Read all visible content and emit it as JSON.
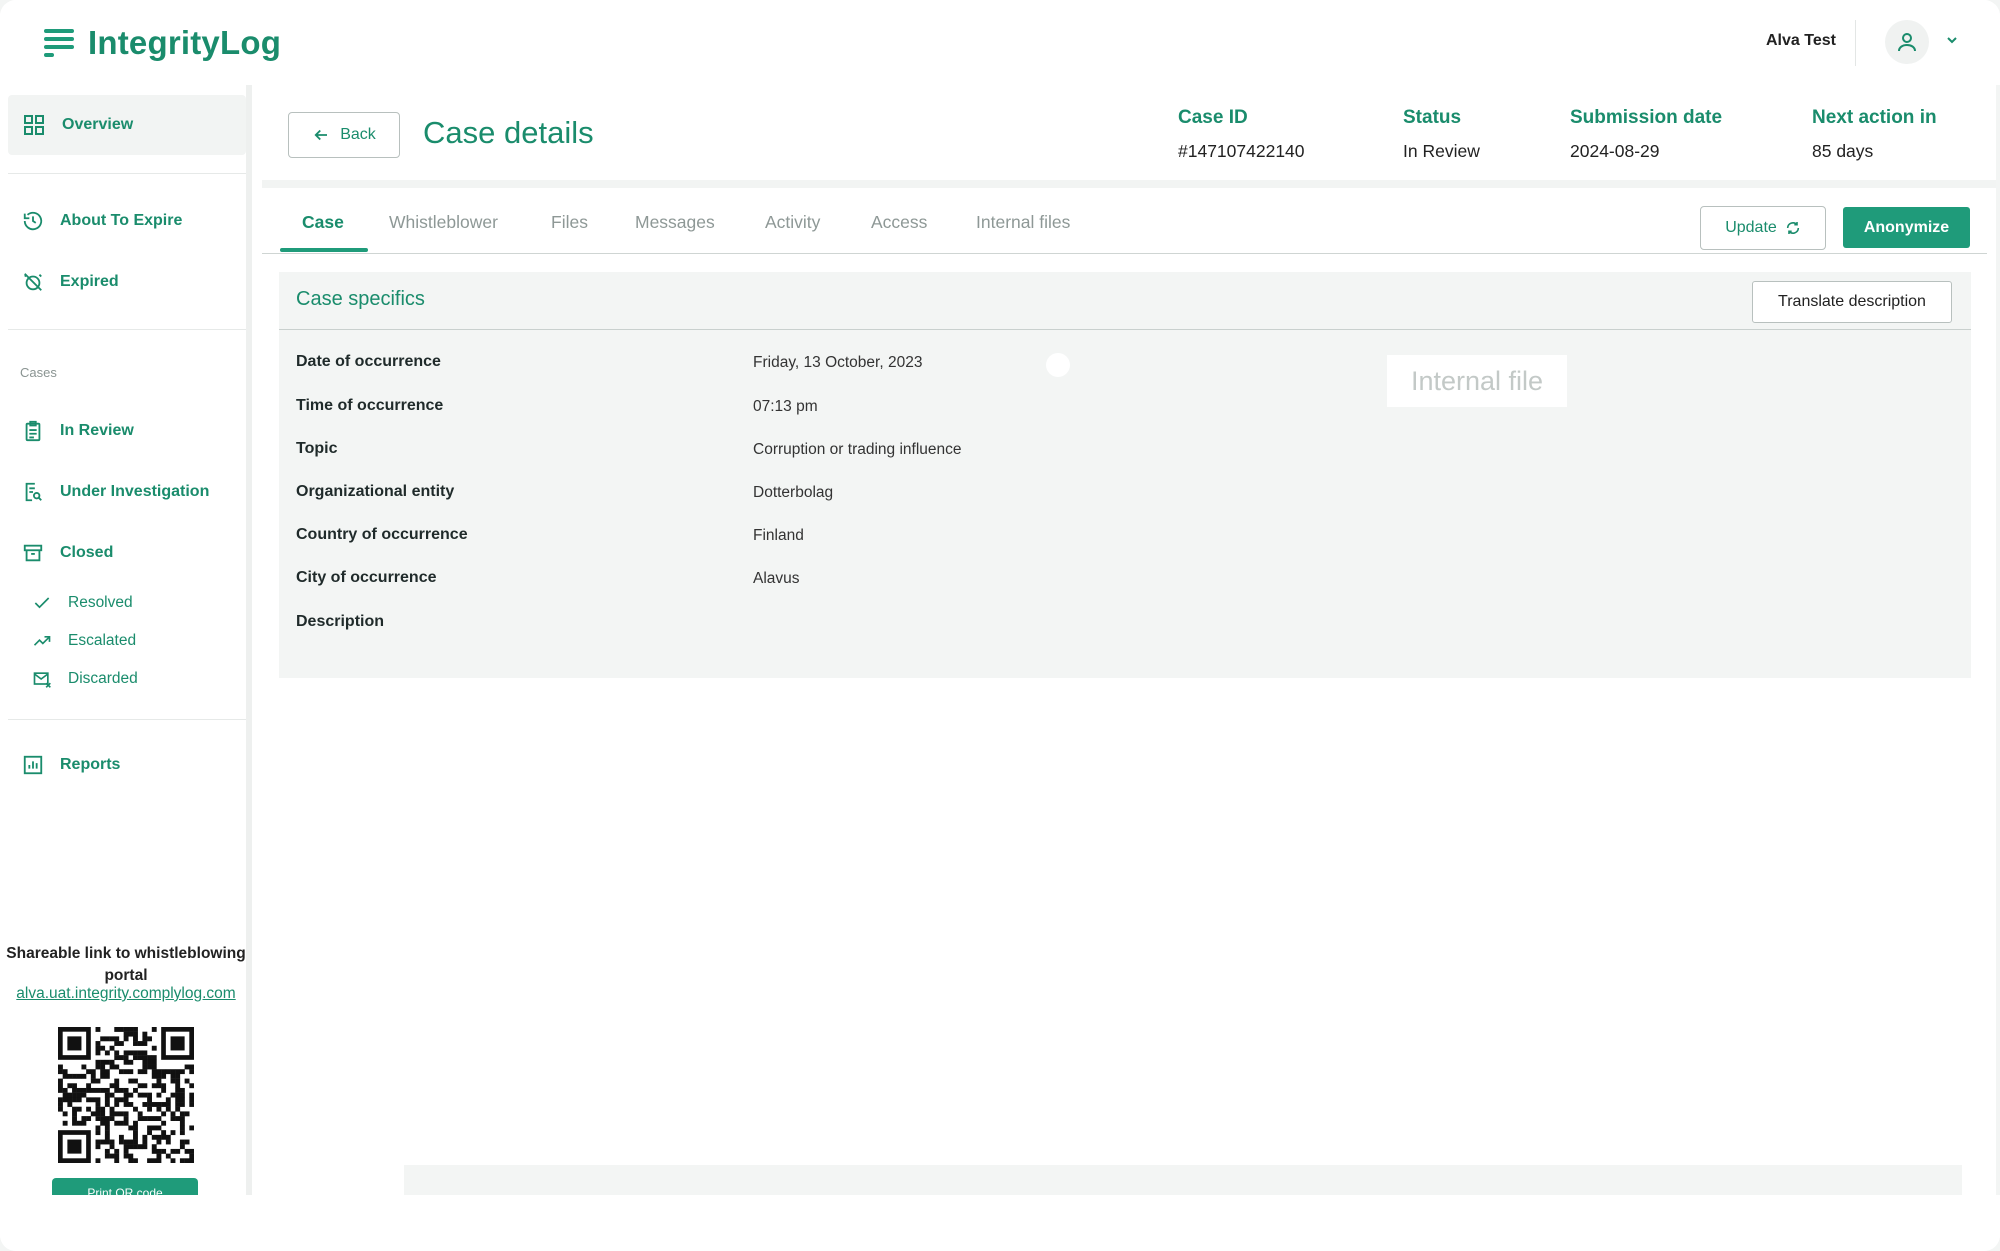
{
  "app": {
    "name": "IntegrityLog"
  },
  "user": {
    "name": "Alva Test",
    "avatar_icon": "user-icon",
    "menu_icon": "chevron-down-icon"
  },
  "sidebar": {
    "overview": "Overview",
    "about_to_expire": "About To Expire",
    "expired": "Expired",
    "cases_label": "Cases",
    "in_review": "In Review",
    "under_investigation": "Under Investigation",
    "closed": "Closed",
    "resolved": "Resolved",
    "escalated": "Escalated",
    "discarded": "Discarded",
    "reports": "Reports",
    "share_text": "Shareable link to whistleblowing portal",
    "share_link": "alva.uat.integrity.complylog.com",
    "print_qr": "Print QR code"
  },
  "case": {
    "back_label": "Back",
    "title": "Case details",
    "case_id_label": "Case ID",
    "case_id": "#147107422140",
    "status_label": "Status",
    "status": "In Review",
    "submission_label": "Submission date",
    "submission_date": "2024-08-29",
    "next_action_label": "Next action in",
    "next_action": "85 days"
  },
  "tabs": [
    "Case",
    "Whistleblower",
    "Files",
    "Messages",
    "Activity",
    "Access",
    "Internal files"
  ],
  "actions": {
    "update": "Update",
    "anonymize": "Anonymize"
  },
  "specifics": {
    "title": "Case specifics",
    "translate": "Translate description",
    "internal_file": "Internal file",
    "rows": [
      {
        "label": "Date of occurrence",
        "value": "Friday, 13 October, 2023"
      },
      {
        "label": "Time of occurrence",
        "value": "07:13 pm"
      },
      {
        "label": "Topic",
        "value": "Corruption or trading influence"
      },
      {
        "label": "Organizational entity",
        "value": "Dotterbolag"
      },
      {
        "label": "Country of occurrence",
        "value": "Finland"
      },
      {
        "label": "City of occurrence",
        "value": "Alavus"
      },
      {
        "label": "Description",
        "value": ""
      }
    ]
  },
  "colors": {
    "brand": "#1a8c6c",
    "button": "#1f9b7a",
    "panel": "#f3f5f4"
  }
}
